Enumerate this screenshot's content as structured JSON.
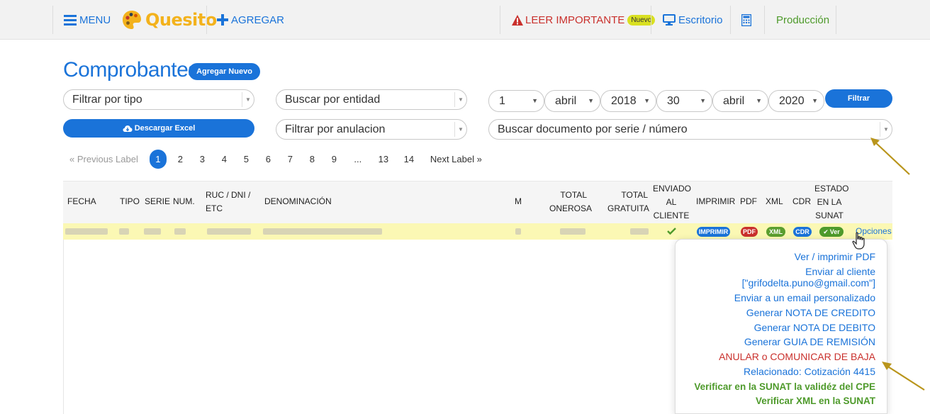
{
  "topbar": {
    "menu": "MENU",
    "brand": "Quesito",
    "add": "AGREGAR",
    "important": "LEER IMPORTANTE",
    "important_badge": "Nuevo",
    "desktop": "Escritorio",
    "environment": "Producción"
  },
  "page": {
    "title": "Comprobantes",
    "add_new": "Agregar Nuevo",
    "download_excel": "Descargar Excel"
  },
  "filters": {
    "type": "Filtrar por tipo",
    "entity": "Buscar por entidad",
    "annulment": "Filtrar por anulacion",
    "doc_search": "Buscar documento por serie / número",
    "from_day": "1",
    "from_month": "abril",
    "from_year": "2018",
    "to_day": "30",
    "to_month": "abril",
    "to_year": "2020",
    "filter_button": "Filtrar"
  },
  "pager": {
    "prev": "«  Previous Label",
    "pages": [
      "2",
      "3",
      "4",
      "5",
      "6",
      "7",
      "8",
      "9",
      "...",
      "13",
      "14"
    ],
    "active": "1",
    "next": "Next Label  »"
  },
  "table": {
    "headers": {
      "fecha": "FECHA",
      "tipo": "TIPO",
      "serie": "SERIE",
      "num": "NUM.",
      "ruc_l1": "RUC / DNI /",
      "ruc_l2": "ETC",
      "denominacion": "DENOMINACIÓN",
      "m": "M",
      "onerosa_l1": "TOTAL",
      "onerosa_l2": "ONEROSA",
      "gratuita_l1": "TOTAL",
      "gratuita_l2": "GRATUITA",
      "enviado_l1": "ENVIADO",
      "enviado_l2": "AL",
      "enviado_l3": "CLIENTE",
      "imprimir": "IMPRIMIR",
      "pdf": "PDF",
      "xml": "XML",
      "cdr": "CDR",
      "estado_l1": "ESTADO",
      "estado_l2": "EN LA",
      "estado_l3": "SUNAT"
    },
    "row": {
      "imprimir": "IMPRIMIR",
      "pdf": "PDF",
      "xml": "XML",
      "cdr": "CDR",
      "estado": "Ver",
      "opciones": "Opciones"
    }
  },
  "options_menu": {
    "items": [
      "Ver / imprimir PDF",
      "Enviar al cliente",
      "[\"grifodelta.puno@gmail.com\"]",
      "Enviar a un email personalizado",
      "Generar NOTA DE CREDITO",
      "Generar NOTA DE DEBITO",
      "Generar GUIA DE REMISIÓN",
      "ANULAR o COMUNICAR DE BAJA",
      "Relacionado: Cotización 4415",
      "Verificar en la SUNAT la validéz del CPE",
      "Verificar XML en la SUNAT"
    ]
  },
  "colors": {
    "primary": "#1a73d9",
    "danger": "#c9302c",
    "success": "#4e9a2b",
    "highlight_row": "#fbf8b4",
    "brand": "#f3b21c"
  }
}
